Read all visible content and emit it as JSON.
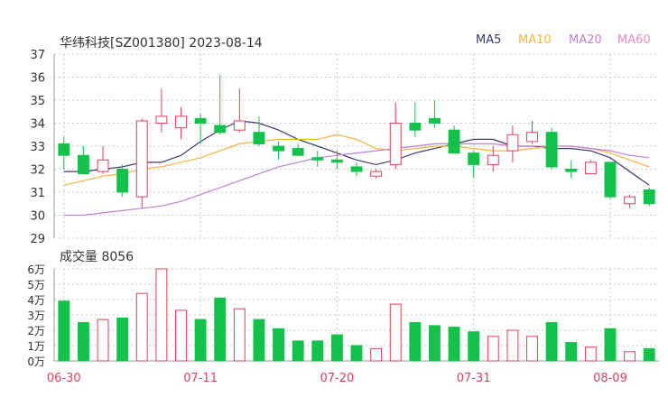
{
  "header": {
    "title": "华纬科技[SZ001380] 2023-08-14",
    "volume_label": "成交量 8056"
  },
  "legend": [
    {
      "name": "MA5",
      "color": "#3a3a6e"
    },
    {
      "name": "MA10",
      "color": "#f5b23d"
    },
    {
      "name": "MA20",
      "color": "#c07fd6"
    },
    {
      "name": "MA60",
      "color": "#e48bc4"
    }
  ],
  "colors": {
    "up": "#e0405e",
    "down": "#12c24a",
    "grid": "#c8c8c8",
    "axis": "#777777"
  },
  "chart_data": [
    {
      "type": "candlestick",
      "title": "华纬科技[SZ001380] 2023-08-14",
      "ylim": [
        29,
        37
      ],
      "y_ticks": [
        29,
        30,
        31,
        32,
        33,
        34,
        35,
        36,
        37
      ],
      "x_tick_labels": [
        {
          "index": 0,
          "label": "06-30"
        },
        {
          "index": 7,
          "label": "07-11"
        },
        {
          "index": 14,
          "label": "07-20"
        },
        {
          "index": 21,
          "label": "07-31"
        },
        {
          "index": 28,
          "label": "08-09"
        }
      ],
      "candles": [
        {
          "o": 33.1,
          "h": 33.4,
          "l": 32.0,
          "c": 32.6
        },
        {
          "o": 32.6,
          "h": 33.0,
          "l": 31.8,
          "c": 31.8
        },
        {
          "o": 31.9,
          "h": 33.0,
          "l": 31.8,
          "c": 32.4
        },
        {
          "o": 32.0,
          "h": 32.2,
          "l": 30.8,
          "c": 31.0
        },
        {
          "o": 30.8,
          "h": 34.2,
          "l": 30.3,
          "c": 34.1
        },
        {
          "o": 34.0,
          "h": 35.5,
          "l": 33.6,
          "c": 34.3
        },
        {
          "o": 33.8,
          "h": 34.7,
          "l": 33.3,
          "c": 34.3
        },
        {
          "o": 34.2,
          "h": 34.4,
          "l": 33.1,
          "c": 34.0
        },
        {
          "o": 33.9,
          "h": 36.1,
          "l": 33.5,
          "c": 33.6
        },
        {
          "o": 33.7,
          "h": 35.5,
          "l": 33.6,
          "c": 34.1
        },
        {
          "o": 33.6,
          "h": 34.3,
          "l": 33.0,
          "c": 33.1
        },
        {
          "o": 33.0,
          "h": 33.2,
          "l": 32.4,
          "c": 32.8
        },
        {
          "o": 32.9,
          "h": 33.1,
          "l": 32.6,
          "c": 32.6
        },
        {
          "o": 32.5,
          "h": 32.8,
          "l": 32.1,
          "c": 32.4
        },
        {
          "o": 32.4,
          "h": 32.8,
          "l": 32.0,
          "c": 32.3
        },
        {
          "o": 32.1,
          "h": 32.3,
          "l": 31.7,
          "c": 31.9
        },
        {
          "o": 31.7,
          "h": 32.0,
          "l": 31.6,
          "c": 31.9
        },
        {
          "o": 32.2,
          "h": 34.9,
          "l": 32.0,
          "c": 34.0
        },
        {
          "o": 34.0,
          "h": 34.9,
          "l": 33.4,
          "c": 33.7
        },
        {
          "o": 34.2,
          "h": 35.0,
          "l": 33.8,
          "c": 34.0
        },
        {
          "o": 33.7,
          "h": 33.9,
          "l": 32.7,
          "c": 32.7
        },
        {
          "o": 32.7,
          "h": 32.8,
          "l": 31.6,
          "c": 32.2
        },
        {
          "o": 32.2,
          "h": 33.0,
          "l": 31.9,
          "c": 32.6
        },
        {
          "o": 32.8,
          "h": 33.9,
          "l": 32.3,
          "c": 33.5
        },
        {
          "o": 33.2,
          "h": 34.1,
          "l": 33.1,
          "c": 33.6
        },
        {
          "o": 33.6,
          "h": 33.8,
          "l": 32.0,
          "c": 32.1
        },
        {
          "o": 32.0,
          "h": 32.4,
          "l": 31.6,
          "c": 31.9
        },
        {
          "o": 31.8,
          "h": 32.4,
          "l": 31.8,
          "c": 32.3
        },
        {
          "o": 32.3,
          "h": 32.3,
          "l": 30.7,
          "c": 30.8
        },
        {
          "o": 30.5,
          "h": 30.9,
          "l": 30.3,
          "c": 30.8
        },
        {
          "o": 31.1,
          "h": 31.2,
          "l": 30.4,
          "c": 30.5
        }
      ],
      "ma": {
        "MA5": [
          31.9,
          31.9,
          32.0,
          32.1,
          32.3,
          32.3,
          32.6,
          33.2,
          33.7,
          34.1,
          34.0,
          33.7,
          33.3,
          33.0,
          32.7,
          32.4,
          32.2,
          32.4,
          32.7,
          32.9,
          33.1,
          33.3,
          33.3,
          33.0,
          33.0,
          32.9,
          32.9,
          32.8,
          32.5,
          31.9,
          31.3
        ],
        "MA10": [
          31.3,
          31.5,
          31.7,
          31.8,
          32.0,
          32.1,
          32.3,
          32.5,
          32.8,
          33.1,
          33.2,
          33.3,
          33.3,
          33.3,
          33.5,
          33.3,
          32.9,
          32.8,
          32.9,
          33.0,
          33.0,
          32.9,
          32.8,
          32.8,
          32.9,
          33.0,
          33.0,
          32.9,
          32.7,
          32.4,
          32.1
        ],
        "MA20": [
          30.0,
          30.0,
          30.1,
          30.2,
          30.3,
          30.4,
          30.6,
          30.9,
          31.2,
          31.5,
          31.8,
          32.1,
          32.3,
          32.5,
          32.6,
          32.7,
          32.8,
          32.9,
          33.0,
          33.1,
          33.1,
          33.1,
          33.1,
          33.0,
          33.0,
          33.0,
          33.0,
          32.9,
          32.8,
          32.6,
          32.5
        ],
        "MA60": []
      }
    },
    {
      "type": "bar",
      "title": "成交量 8056",
      "ylim": [
        0,
        6
      ],
      "y_ticks": [
        {
          "value": 0,
          "label": "0万"
        },
        {
          "value": 1,
          "label": "1万"
        },
        {
          "value": 2,
          "label": "2万"
        },
        {
          "value": 3,
          "label": "3万"
        },
        {
          "value": 4,
          "label": "4万"
        },
        {
          "value": 5,
          "label": "5万"
        },
        {
          "value": 6,
          "label": "6万"
        }
      ],
      "volumes": [
        3.9,
        2.5,
        2.7,
        2.8,
        4.4,
        6.0,
        3.3,
        2.7,
        4.1,
        3.4,
        2.7,
        2.1,
        1.3,
        1.3,
        1.7,
        1.0,
        0.8,
        3.7,
        2.5,
        2.3,
        2.2,
        1.9,
        1.6,
        2.0,
        1.6,
        2.5,
        1.2,
        0.9,
        2.1,
        0.6,
        0.8
      ]
    }
  ]
}
